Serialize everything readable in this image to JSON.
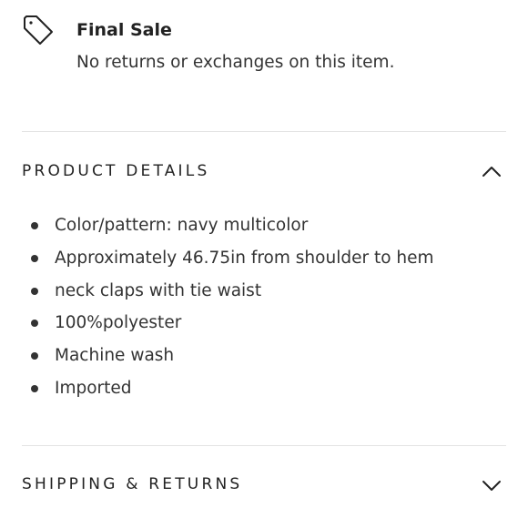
{
  "final_sale": {
    "icon": "tag-icon",
    "title": "Final Sale",
    "subtitle": "No returns or exchanges on this item."
  },
  "product_details": {
    "title": "PRODUCT DETAILS",
    "expanded": true,
    "toggle_icon": "chevron-up-icon",
    "items": [
      "Color/pattern: navy multicolor",
      "Approximately 46.75in from shoulder to hem",
      "neck claps with tie waist",
      "100%polyester",
      "Machine wash",
      "Imported"
    ]
  },
  "shipping_returns": {
    "title": "SHIPPING & RETURNS",
    "expanded": false,
    "toggle_icon": "chevron-down-icon"
  },
  "colors": {
    "text": "#222222",
    "divider": "#e3e3e3"
  }
}
